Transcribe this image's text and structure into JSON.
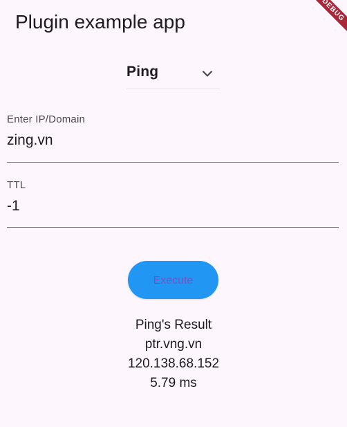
{
  "app_bar": {
    "title": "Plugin example app",
    "debug_banner": "DEBUG"
  },
  "dropdown": {
    "selected": "Ping"
  },
  "ip_field": {
    "label": "Enter IP/Domain",
    "value": "zing.vn"
  },
  "ttl_field": {
    "label": "TTL",
    "value": "-1"
  },
  "execute": {
    "label": "Execute"
  },
  "result": {
    "title": "Ping's Result",
    "host": "ptr.vng.vn",
    "ip": "120.138.68.152",
    "time": "5.79 ms"
  },
  "colors": {
    "background": "#fdf7fd",
    "button": "#2196f3",
    "button_text": "#7a4fc2",
    "debug_ribbon": "#a8283a"
  },
  "icons": {
    "dropdown": "chevron-down-icon"
  }
}
